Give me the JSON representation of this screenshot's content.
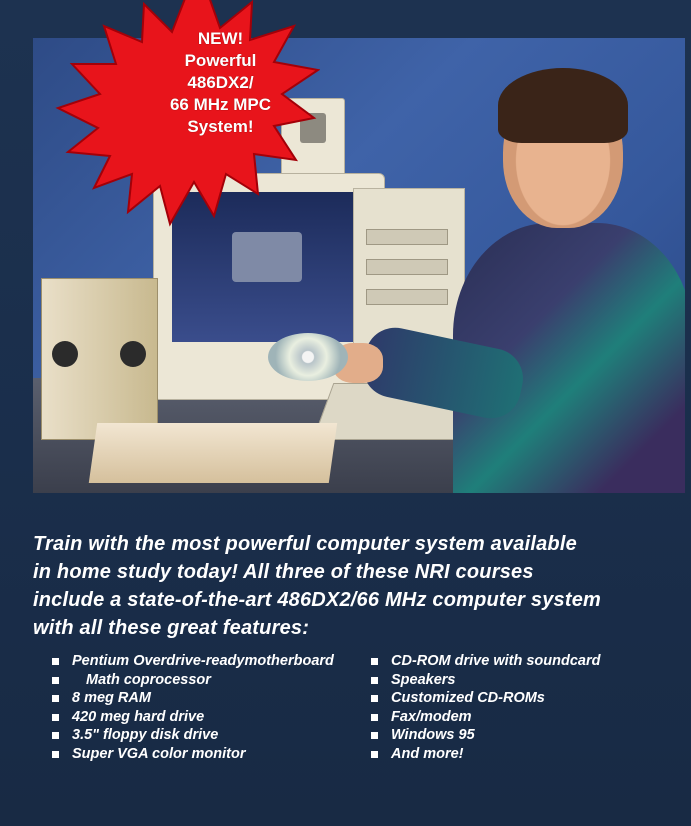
{
  "burst": {
    "lines": [
      "NEW!",
      "Powerful",
      "486DX2/",
      "66 MHz MPC",
      "System!"
    ]
  },
  "intro": {
    "lines": [
      "Train with the most powerful computer system available",
      "in home study today! All three of these NRI courses",
      "include a state-of-the-art 486DX2/66 MHz computer system",
      "with all these great features:"
    ]
  },
  "features_left": [
    [
      "Pentium Overdrive-ready",
      "motherboard"
    ],
    [
      "Math coprocessor"
    ],
    [
      "8 meg RAM"
    ],
    [
      "420 meg hard drive"
    ],
    [
      "3.5\" floppy disk drive"
    ],
    [
      "Super VGA color monitor"
    ]
  ],
  "features_right": [
    [
      "CD-ROM drive with sound",
      "card"
    ],
    [
      "Speakers"
    ],
    [
      "Customized CD-ROMs"
    ],
    [
      "Fax/modem"
    ],
    [
      "Windows 95"
    ],
    [
      "And more!"
    ]
  ],
  "colors": {
    "background": "#1a2f4a",
    "burst_fill": "#e8141b",
    "burst_stroke": "#a30008",
    "text": "#ffffff"
  },
  "icons": {
    "bullet": "square-bullet-icon"
  }
}
